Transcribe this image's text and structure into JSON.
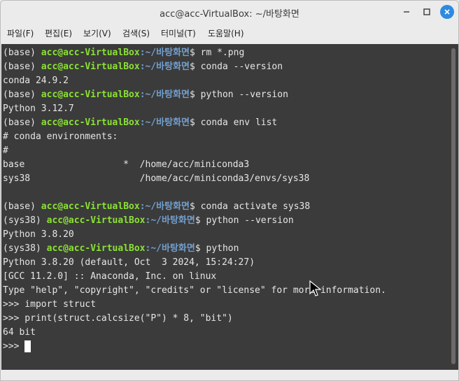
{
  "window": {
    "title": "acc@acc-VirtualBox: ~/바탕화면"
  },
  "menubar": {
    "items": [
      "파일(F)",
      "편집(E)",
      "보기(V)",
      "검색(S)",
      "터미널(T)",
      "도움말(H)"
    ]
  },
  "terminal": {
    "lines": [
      {
        "env": "(base) ",
        "user": "acc@acc-VirtualBox",
        "path": ":~/바탕화면",
        "prompt": "$ ",
        "cmd": "rm *.png"
      },
      {
        "env": "(base) ",
        "user": "acc@acc-VirtualBox",
        "path": ":~/바탕화면",
        "prompt": "$ ",
        "cmd": "conda --version"
      },
      {
        "text": "conda 24.9.2"
      },
      {
        "env": "(base) ",
        "user": "acc@acc-VirtualBox",
        "path": ":~/바탕화면",
        "prompt": "$ ",
        "cmd": "python --version"
      },
      {
        "text": "Python 3.12.7"
      },
      {
        "env": "(base) ",
        "user": "acc@acc-VirtualBox",
        "path": ":~/바탕화면",
        "prompt": "$ ",
        "cmd": "conda env list"
      },
      {
        "text": "# conda environments:"
      },
      {
        "text": "#"
      },
      {
        "text": "base                  *  /home/acc/miniconda3"
      },
      {
        "text": "sys38                    /home/acc/miniconda3/envs/sys38"
      },
      {
        "text": ""
      },
      {
        "env": "(base) ",
        "user": "acc@acc-VirtualBox",
        "path": ":~/바탕화면",
        "prompt": "$ ",
        "cmd": "conda activate sys38"
      },
      {
        "env": "(sys38) ",
        "user": "acc@acc-VirtualBox",
        "path": ":~/바탕화면",
        "prompt": "$ ",
        "cmd": "python --version"
      },
      {
        "text": "Python 3.8.20"
      },
      {
        "env": "(sys38) ",
        "user": "acc@acc-VirtualBox",
        "path": ":~/바탕화면",
        "prompt": "$ ",
        "cmd": "python"
      },
      {
        "text": "Python 3.8.20 (default, Oct  3 2024, 15:24:27)"
      },
      {
        "text": "[GCC 11.2.0] :: Anaconda, Inc. on linux"
      },
      {
        "text": "Type \"help\", \"copyright\", \"credits\" or \"license\" for more information."
      },
      {
        "text": ">>> import struct"
      },
      {
        "text": ">>> print(struct.calcsize(\"P\") * 8, \"bit\")"
      },
      {
        "text": "64 bit"
      },
      {
        "text": ">>> ",
        "cursor": true
      }
    ]
  },
  "colors": {
    "background": "#3b3b3b",
    "foreground": "#e6e6e6",
    "user": "#8ae234",
    "path": "#729fcf",
    "close_button": "#2d8ae0"
  },
  "icons": [
    "minimize-icon",
    "maximize-icon",
    "close-icon",
    "mouse-pointer-icon"
  ]
}
